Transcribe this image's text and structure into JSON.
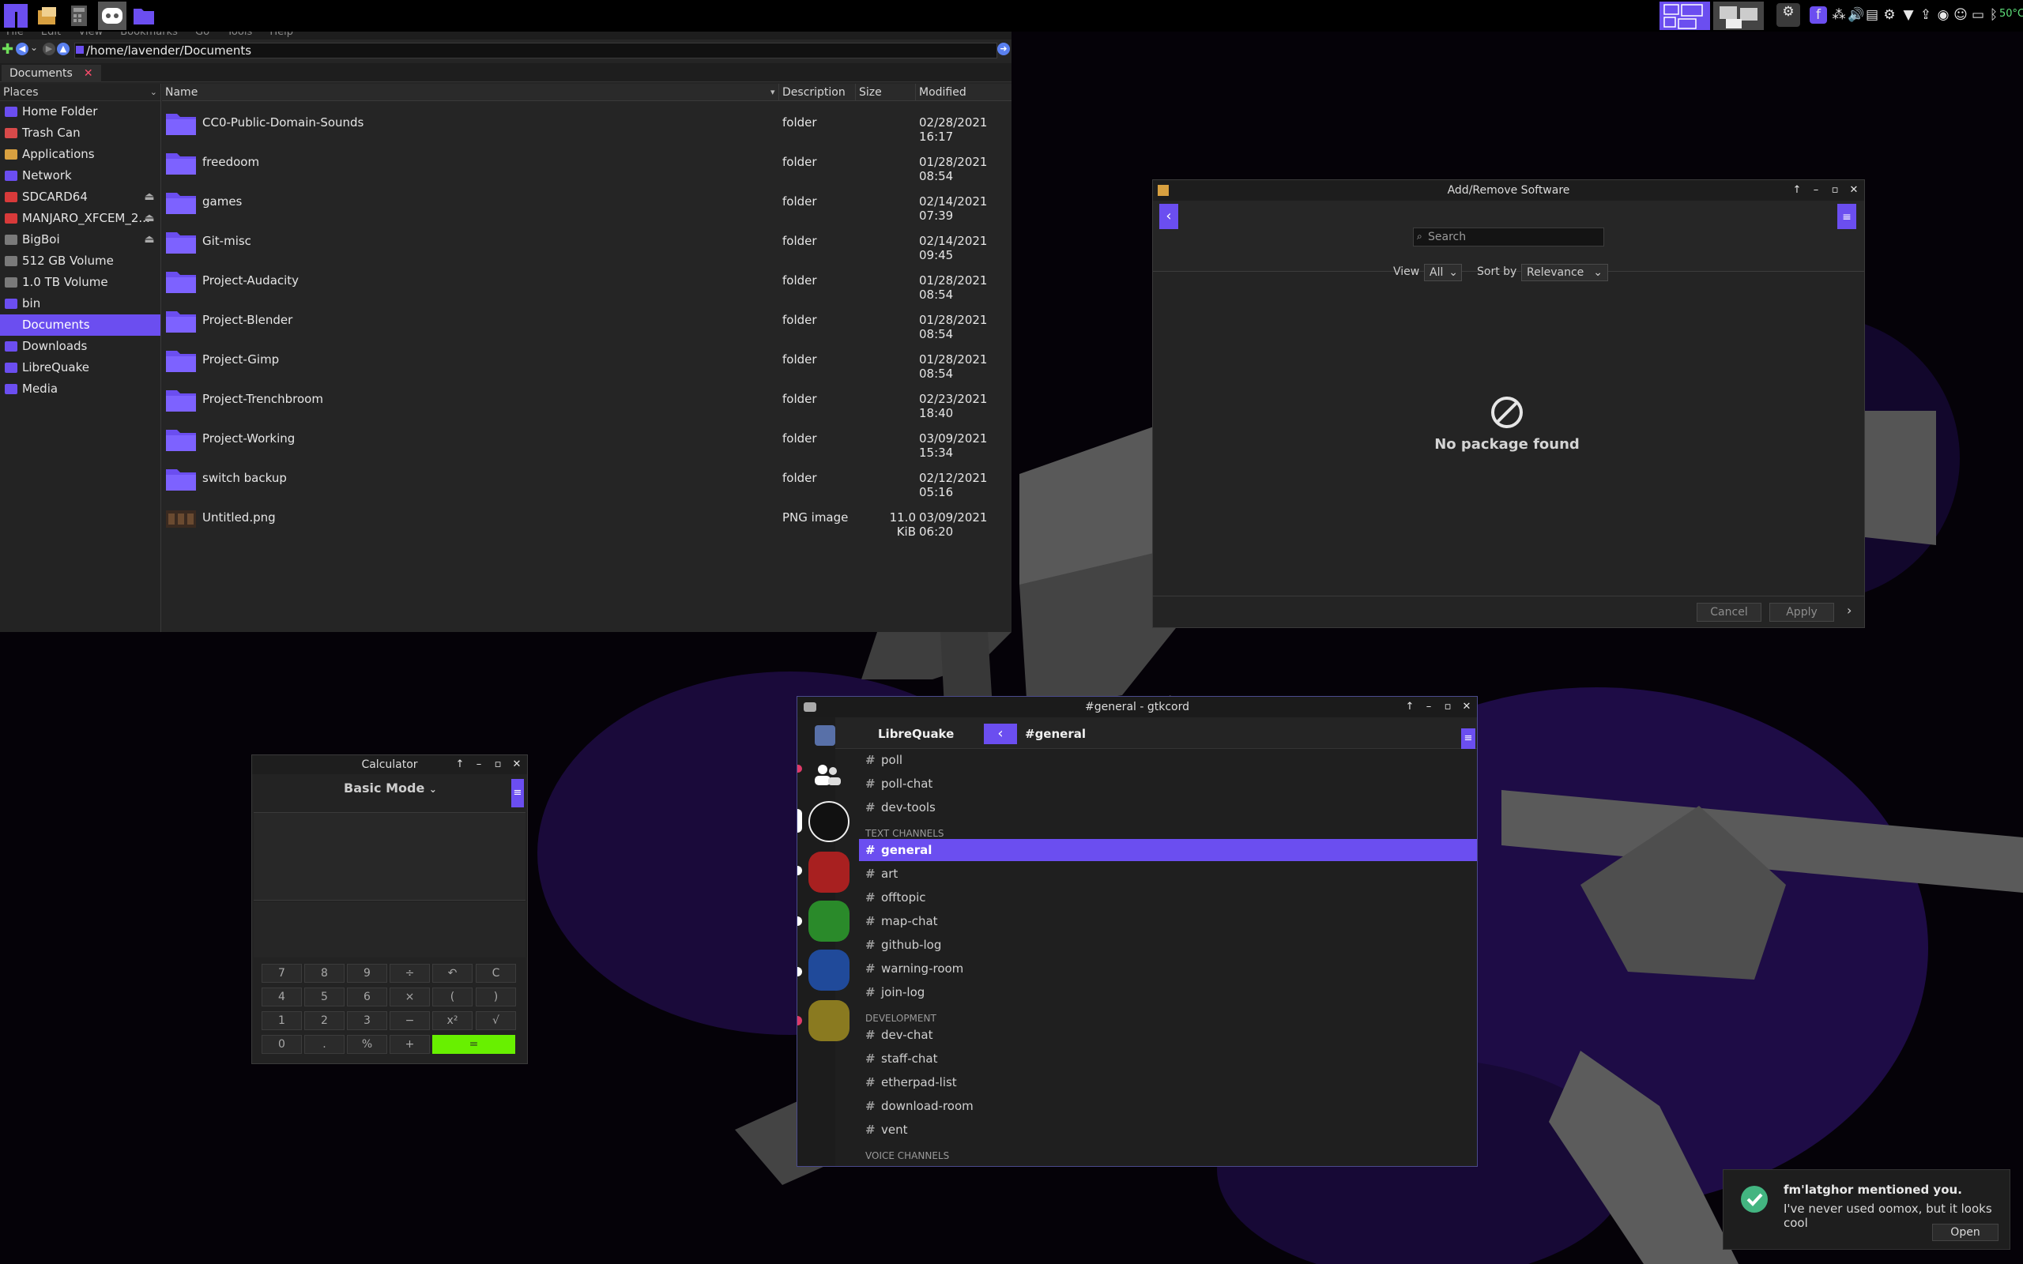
{
  "panel": {
    "temperature": "50°C"
  },
  "file_manager": {
    "menu": [
      "File",
      "Edit",
      "View",
      "Bookmarks",
      "Go",
      "Tools",
      "Help"
    ],
    "path": "/home/lavender/Documents",
    "tab_label": "Documents",
    "places_header": "Places",
    "places": [
      {
        "label": "Home Folder",
        "color": "#6b4ef0"
      },
      {
        "label": "Trash Can",
        "color": "#d84a4a"
      },
      {
        "label": "Applications",
        "color": "#d8a040"
      },
      {
        "label": "Network",
        "color": "#6b4ef0"
      },
      {
        "label": "SDCARD64",
        "color": "#d83a3a"
      },
      {
        "label": "MANJARO_XFCEM_2...",
        "color": "#d83a3a"
      },
      {
        "label": "BigBoi",
        "color": "#7a7a7a"
      },
      {
        "label": "512 GB Volume",
        "color": "#7a7a7a"
      },
      {
        "label": "1.0 TB Volume",
        "color": "#7a7a7a"
      },
      {
        "label": "bin",
        "color": "#6b4ef0"
      },
      {
        "label": "Documents",
        "color": "#6b4ef0"
      },
      {
        "label": "Downloads",
        "color": "#6b4ef0"
      },
      {
        "label": "LibreQuake",
        "color": "#6b4ef0"
      },
      {
        "label": "Media",
        "color": "#6b4ef0"
      }
    ],
    "columns": {
      "name": "Name",
      "description": "Description",
      "size": "Size",
      "modified": "Modified"
    },
    "rows": [
      {
        "name": "CC0-Public-Domain-Sounds",
        "description": "folder",
        "size": "",
        "modified": "02/28/2021 16:17"
      },
      {
        "name": "freedoom",
        "description": "folder",
        "size": "",
        "modified": "01/28/2021 08:54"
      },
      {
        "name": "games",
        "description": "folder",
        "size": "",
        "modified": "02/14/2021 07:39"
      },
      {
        "name": "Git-misc",
        "description": "folder",
        "size": "",
        "modified": "02/14/2021 09:45"
      },
      {
        "name": "Project-Audacity",
        "description": "folder",
        "size": "",
        "modified": "01/28/2021 08:54"
      },
      {
        "name": "Project-Blender",
        "description": "folder",
        "size": "",
        "modified": "01/28/2021 08:54"
      },
      {
        "name": "Project-Gimp",
        "description": "folder",
        "size": "",
        "modified": "01/28/2021 08:54"
      },
      {
        "name": "Project-Trenchbroom",
        "description": "folder",
        "size": "",
        "modified": "02/23/2021 18:40"
      },
      {
        "name": "Project-Working",
        "description": "folder",
        "size": "",
        "modified": "03/09/2021 15:34"
      },
      {
        "name": "switch backup",
        "description": "folder",
        "size": "",
        "modified": "02/12/2021 05:16"
      },
      {
        "name": "Untitled.png",
        "description": "PNG image",
        "size": "11.0 KiB",
        "modified": "03/09/2021 06:20"
      }
    ]
  },
  "software": {
    "title": "Add/Remove Software",
    "search_placeholder": "Search",
    "view_label": "View",
    "view_value": "All",
    "sort_label": "Sort by",
    "sort_value": "Relevance",
    "empty_text": "No package found",
    "cancel": "Cancel",
    "apply": "Apply"
  },
  "calculator": {
    "title": "Calculator",
    "mode": "Basic Mode",
    "keys": [
      [
        "7",
        "8",
        "9",
        "÷",
        "↶",
        "C"
      ],
      [
        "4",
        "5",
        "6",
        "×",
        "(",
        ")"
      ],
      [
        "1",
        "2",
        "3",
        "−",
        "x²",
        "√"
      ],
      [
        "0",
        ".",
        "%",
        "+",
        "="
      ]
    ]
  },
  "gtkcord": {
    "title": "#general - gtkcord",
    "guild_name": "LibreQuake",
    "channel_title": "#general",
    "items": [
      {
        "kind": "channel",
        "label": "poll"
      },
      {
        "kind": "channel",
        "label": "poll-chat"
      },
      {
        "kind": "channel",
        "label": "dev-tools"
      },
      {
        "kind": "category",
        "label": "TEXT CHANNELS"
      },
      {
        "kind": "channel",
        "label": "general",
        "selected": true
      },
      {
        "kind": "channel",
        "label": "art"
      },
      {
        "kind": "channel",
        "label": "offtopic"
      },
      {
        "kind": "channel",
        "label": "map-chat"
      },
      {
        "kind": "channel",
        "label": "github-log"
      },
      {
        "kind": "channel",
        "label": "warning-room"
      },
      {
        "kind": "channel",
        "label": "join-log"
      },
      {
        "kind": "category",
        "label": "DEVELOPMENT"
      },
      {
        "kind": "channel",
        "label": "dev-chat"
      },
      {
        "kind": "channel",
        "label": "staff-chat"
      },
      {
        "kind": "channel",
        "label": "etherpad-list"
      },
      {
        "kind": "channel",
        "label": "download-room"
      },
      {
        "kind": "channel",
        "label": "vent"
      },
      {
        "kind": "category",
        "label": "VOICE CHANNELS"
      }
    ]
  },
  "notification": {
    "title": "fm'latghor mentioned you.",
    "body": "I've never used oomox, but it looks cool",
    "action": "Open"
  },
  "colors": {
    "accent": "#6b4ef0",
    "calc_equals": "#68f000",
    "notification_icon": "#43b581"
  }
}
